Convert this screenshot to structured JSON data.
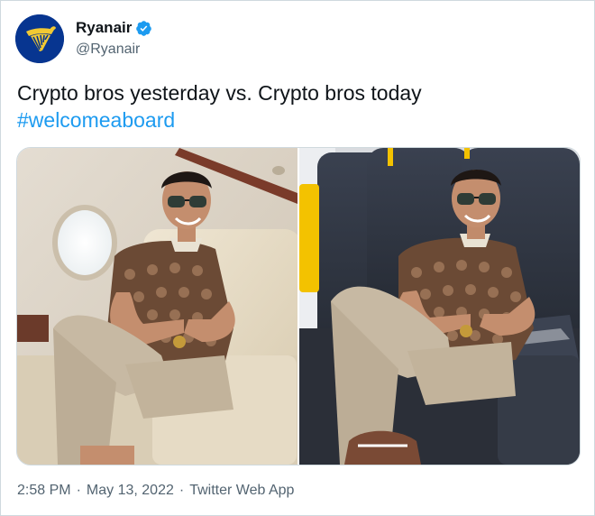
{
  "account": {
    "display_name": "Ryanair",
    "handle": "@Ryanair",
    "verified": true,
    "avatar_icon": "ryanair-harp-logo",
    "brand_color": "#073590",
    "logo_color": "#f1c933"
  },
  "tweet": {
    "text_line1": "Crypto bros yesterday vs. Crypto bros today",
    "hashtag": "#welcomeaboard",
    "hashtag_color": "#1d9bf0"
  },
  "media": {
    "left_photo": "man-in-private-jet-seat",
    "right_photo": "man-in-budget-airline-seat"
  },
  "meta": {
    "time": "2:58 PM",
    "separator": "·",
    "date": "May 13, 2022",
    "source": "Twitter Web App"
  }
}
